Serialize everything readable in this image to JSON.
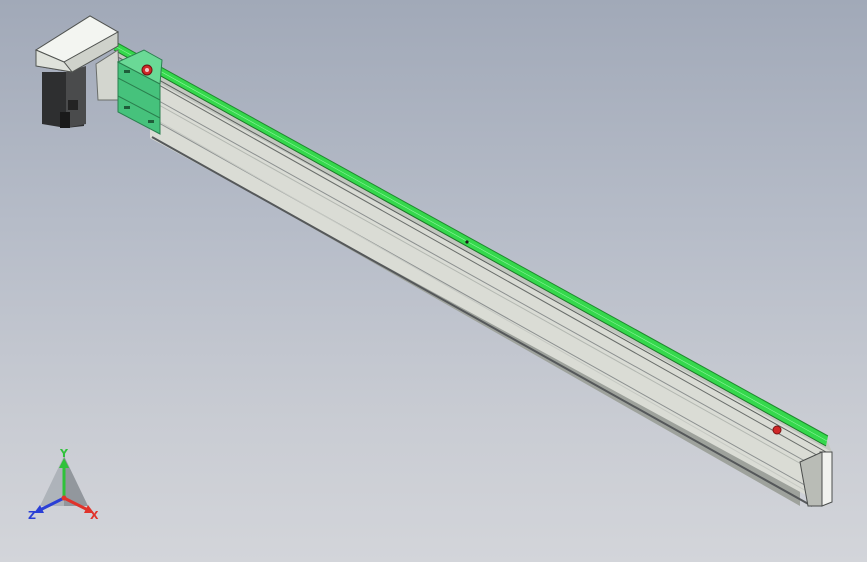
{
  "viewport": {
    "background_top": "#a1a9b8",
    "background_bottom": "#d3d5da"
  },
  "model": {
    "parts": [
      "motor-housing",
      "motor-body",
      "carriage-block",
      "profile-beam",
      "guide-rail",
      "end-cap",
      "limit-sensor-near",
      "limit-sensor-far"
    ],
    "colors": {
      "profile": "#d9dcd4",
      "profile_shadow": "#9ea29c",
      "rail": "#35d84c",
      "carriage": "#45c07a",
      "motor": "#3a3a3a",
      "housing": "#ecefe8",
      "sensor": "#d02828"
    }
  },
  "triad": {
    "x_label": "X",
    "y_label": "Y",
    "z_label": "Z",
    "x_color": "#e0332b",
    "y_color": "#2fc23a",
    "z_color": "#2a3fd6"
  }
}
